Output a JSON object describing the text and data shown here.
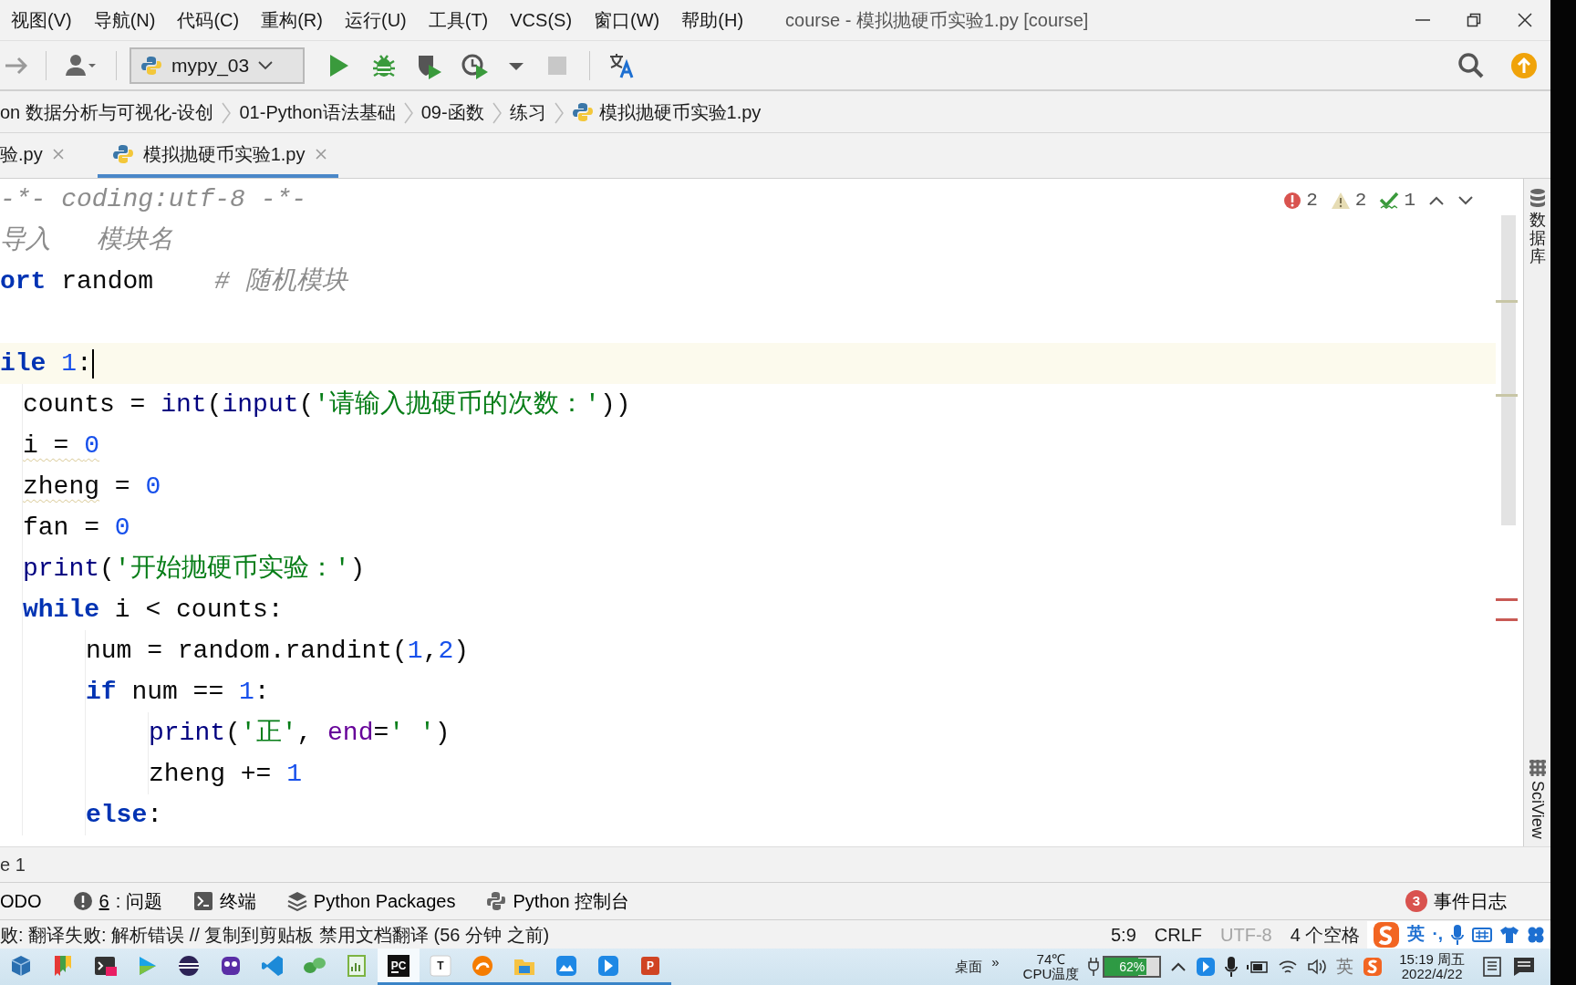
{
  "title_bar": {
    "menus": [
      "视图(V)",
      "导航(N)",
      "代码(C)",
      "重构(R)",
      "运行(U)",
      "工具(T)",
      "VCS(S)",
      "窗口(W)",
      "帮助(H)"
    ],
    "title": "course - 模拟抛硬币实验1.py [course]"
  },
  "toolbar": {
    "run_config": "mypy_03",
    "stop_disabled": true
  },
  "breadcrumb": [
    {
      "label": "on 数据分析与可视化-设创",
      "kind": "folder"
    },
    {
      "label": "01-Python语法基础",
      "kind": "folder"
    },
    {
      "label": "09-函数",
      "kind": "folder"
    },
    {
      "label": "练习",
      "kind": "folder"
    },
    {
      "label": "模拟抛硬币实验1.py",
      "kind": "file"
    }
  ],
  "tabs": [
    {
      "label": "验.py",
      "selected": false
    },
    {
      "label": "模拟抛硬币实验1.py",
      "selected": true
    }
  ],
  "inspections": {
    "errors": "2",
    "warnings": "2",
    "typos": "1"
  },
  "code": [
    {
      "current": false,
      "tokens": [
        {
          "kind": "comment",
          "text": "-*- coding:utf-8 -*-"
        }
      ]
    },
    {
      "current": false,
      "tokens": [
        {
          "kind": "comment",
          "text": "导入   模块名"
        }
      ]
    },
    {
      "current": false,
      "tokens": [
        {
          "kind": "keyword",
          "text": "ort"
        },
        {
          "kind": "plain",
          "text": " random    "
        },
        {
          "kind": "comment",
          "text": "# 随机模块"
        }
      ]
    },
    {
      "current": false
    },
    {
      "current": true,
      "tokens": [
        {
          "kind": "keyword",
          "text": "ile "
        },
        {
          "kind": "number",
          "text": "1"
        },
        {
          "kind": "plain",
          "text": ":"
        }
      ],
      "children": [
        {
          "current": false,
          "tokens": [
            {
              "kind": "plain",
              "text": "counts = "
            },
            {
              "kind": "builtin",
              "text": "int"
            },
            {
              "kind": "plain",
              "text": "("
            },
            {
              "kind": "builtin",
              "text": "input"
            },
            {
              "kind": "plain",
              "text": "("
            },
            {
              "kind": "string",
              "text": "'请输入抛硬币的次数：'"
            },
            {
              "kind": "plain",
              "text": "))"
            }
          ]
        },
        {
          "current": false,
          "tokens": [
            {
              "kind": "plain",
              "text": "i = ",
              "warned": true
            },
            {
              "kind": "number",
              "text": "0",
              "warned": true
            }
          ]
        },
        {
          "current": false,
          "tokens": [
            {
              "kind": "plain",
              "text": "zheng",
              "warned": true
            },
            {
              "kind": "plain",
              "text": " = "
            },
            {
              "kind": "number",
              "text": "0"
            }
          ]
        },
        {
          "current": false,
          "tokens": [
            {
              "kind": "plain",
              "text": "fan = "
            },
            {
              "kind": "number",
              "text": "0"
            }
          ]
        },
        {
          "current": false,
          "tokens": [
            {
              "kind": "builtin",
              "text": "print"
            },
            {
              "kind": "plain",
              "text": "("
            },
            {
              "kind": "string",
              "text": "'开始抛硬币实验：'"
            },
            {
              "kind": "plain",
              "text": ")"
            }
          ]
        },
        {
          "current": false,
          "tokens": [
            {
              "kind": "keyword",
              "text": "while"
            },
            {
              "kind": "plain",
              "text": " i < counts:"
            }
          ],
          "children": [
            {
              "current": false,
              "tokens": [
                {
                  "kind": "plain",
                  "text": "num = random.randint("
                },
                {
                  "kind": "number",
                  "text": "1"
                },
                {
                  "kind": "plain",
                  "text": ","
                },
                {
                  "kind": "number",
                  "text": "2"
                },
                {
                  "kind": "plain",
                  "text": ")"
                }
              ]
            },
            {
              "current": false,
              "tokens": [
                {
                  "kind": "keyword",
                  "text": "if"
                },
                {
                  "kind": "plain",
                  "text": " num == "
                },
                {
                  "kind": "number",
                  "text": "1"
                },
                {
                  "kind": "plain",
                  "text": ":"
                }
              ],
              "children": [
                {
                  "current": false,
                  "tokens": [
                    {
                      "kind": "builtin",
                      "text": "print"
                    },
                    {
                      "kind": "plain",
                      "text": "("
                    },
                    {
                      "kind": "string",
                      "text": "'正'"
                    },
                    {
                      "kind": "plain",
                      "text": ", "
                    },
                    {
                      "kind": "param",
                      "text": "end"
                    },
                    {
                      "kind": "plain",
                      "text": "="
                    },
                    {
                      "kind": "string",
                      "text": "' '"
                    },
                    {
                      "kind": "plain",
                      "text": ")"
                    }
                  ]
                },
                {
                  "current": false,
                  "tokens": [
                    {
                      "kind": "plain",
                      "text": "zheng += "
                    },
                    {
                      "kind": "number",
                      "text": "1"
                    }
                  ]
                }
              ]
            },
            {
              "current": false,
              "tokens": [
                {
                  "kind": "keyword",
                  "text": "else"
                },
                {
                  "kind": "plain",
                  "text": ":"
                }
              ]
            }
          ]
        }
      ]
    }
  ],
  "side_tools": [
    {
      "label": "数据库",
      "kind": "database"
    },
    {
      "label": "SciView",
      "kind": "sciview"
    }
  ],
  "editor_breadcrumb": "e 1",
  "tool_windows": [
    {
      "label": "ODO",
      "kind": "plain"
    },
    {
      "mnemonic": "6",
      "label": ": 问题",
      "kind": "problems"
    },
    {
      "label": "终端",
      "kind": "terminal"
    },
    {
      "label": "Python Packages",
      "kind": "packages"
    },
    {
      "label": "Python 控制台",
      "kind": "console"
    }
  ],
  "event_log": {
    "count": "3",
    "label": "事件日志"
  },
  "status": {
    "message": "败: 翻译失败: 解析错误 // 复制到剪贴板   禁用文档翻译 (56 分钟 之前)",
    "position": "5:9",
    "line_separator": "CRLF",
    "encoding": "UTF-8",
    "encoding_disabled": true,
    "indent": "4 个空格"
  },
  "ime_toolbar": {
    "mode": "英",
    "punctuation": "·,"
  },
  "taskbar": {
    "apps": [
      {
        "kind": "cube",
        "active": false,
        "running": false
      },
      {
        "kind": "pin",
        "active": false,
        "running": false
      },
      {
        "kind": "terminal",
        "active": false,
        "running": false
      },
      {
        "kind": "player",
        "active": false,
        "running": false
      },
      {
        "kind": "eclipse",
        "active": false,
        "running": false
      },
      {
        "kind": "gopher",
        "active": false,
        "running": false
      },
      {
        "kind": "vscode",
        "active": false,
        "running": false
      },
      {
        "kind": "leaf",
        "active": false,
        "running": false
      },
      {
        "kind": "notepad",
        "active": false,
        "running": false
      },
      {
        "kind": "pycharm",
        "label": "PC",
        "active": true,
        "running": true
      },
      {
        "kind": "typora",
        "label": "T",
        "active": false,
        "running": true
      },
      {
        "kind": "swirl",
        "active": false,
        "running": true
      },
      {
        "kind": "folder",
        "active": false,
        "running": true
      },
      {
        "kind": "cloud",
        "active": false,
        "running": true
      },
      {
        "kind": "arrow",
        "active": false,
        "running": true
      },
      {
        "kind": "slides",
        "label": "P",
        "active": false,
        "running": true
      }
    ],
    "desktop": "桌面",
    "more": "»",
    "temperature": "74℃",
    "temperature_label": "CPU温度",
    "battery": {
      "text": "62%",
      "level": 0.62
    },
    "ime": "英",
    "time": "15:19 周五",
    "date": "2022/4/22"
  }
}
